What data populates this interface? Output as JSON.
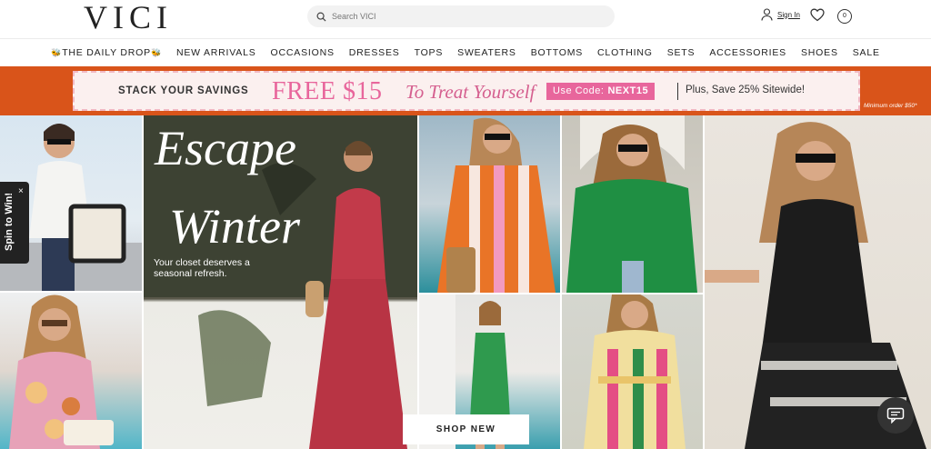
{
  "header": {
    "logo": "VICI",
    "search_placeholder": "Search VICI",
    "signin_label": "Sign In",
    "bag_count": "0"
  },
  "nav": {
    "items": [
      "THE DAILY DROP",
      "NEW ARRIVALS",
      "OCCASIONS",
      "DRESSES",
      "TOPS",
      "SWEATERS",
      "BOTTOMS",
      "CLOTHING",
      "SETS",
      "ACCESSORIES",
      "SHOES",
      "SALE"
    ]
  },
  "promo": {
    "stack": "STACK YOUR SAVINGS",
    "free": "FREE $15",
    "treat": "To Treat Yourself",
    "use_code": "Use Code:",
    "code": "NEXT15",
    "plus": "Plus, Save 25% Sitewide!",
    "minimum": "Minimum order $50*"
  },
  "hero": {
    "escape_line1": "Escape",
    "escape_line2": "Winter",
    "subtitle": "Your closet deserves a seasonal refresh.",
    "shop_button": "SHOP NEW"
  },
  "spin_widget": {
    "label": "Spin to Win!",
    "close": "×"
  },
  "colors": {
    "promo_bg": "#d9541a",
    "promo_pink": "#e8669c",
    "nav_text": "#222222"
  }
}
